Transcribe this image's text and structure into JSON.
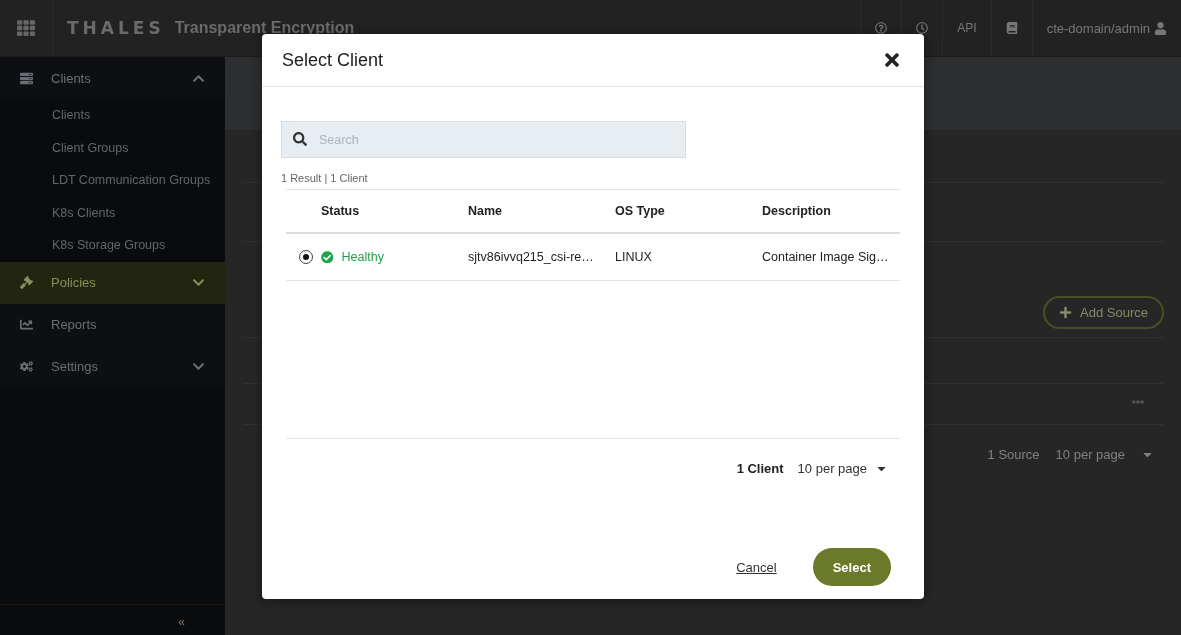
{
  "topbar": {
    "logo": "THALES",
    "product": "Transparent Encryption",
    "api": "API",
    "user": "cte-domain/admin"
  },
  "sidebar": {
    "items": [
      {
        "label": "Clients",
        "expanded": true,
        "selected": false,
        "children": [
          {
            "label": "Clients"
          },
          {
            "label": "Client Groups"
          },
          {
            "label": "LDT Communication Groups"
          },
          {
            "label": "K8s Clients"
          },
          {
            "label": "K8s Storage Groups"
          }
        ]
      },
      {
        "label": "Policies",
        "expanded": false,
        "selected": true
      },
      {
        "label": "Reports",
        "selected": false
      },
      {
        "label": "Settings",
        "expanded": false,
        "selected": false
      }
    ],
    "collapse": "«"
  },
  "background": {
    "add_button": "Add Source",
    "pager": {
      "count": "1 Source",
      "per_page": "10 per page"
    }
  },
  "dialog": {
    "title": "Select Client",
    "search": {
      "placeholder": "Search"
    },
    "result_summary": "1 Result | 1 Client",
    "table": {
      "columns": [
        "Status",
        "Name",
        "OS Type",
        "Description"
      ],
      "rows": [
        {
          "selected": true,
          "status": {
            "text": "Healthy",
            "kind": "healthy"
          },
          "name": "sjtv86ivvq215_csi-re…",
          "os_type": "LINUX",
          "description": "Container Image Sig…"
        }
      ]
    },
    "pager": {
      "count": "1 Client",
      "per_page": "10 per page"
    },
    "buttons": {
      "cancel": "Cancel",
      "confirm": "Select"
    }
  }
}
